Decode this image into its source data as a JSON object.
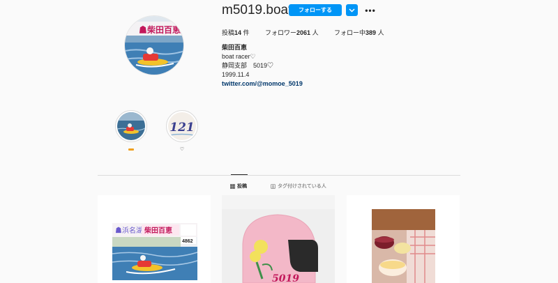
{
  "profile": {
    "username": "m5019.boat",
    "follow_label": "フォローする",
    "name": "柴田百恵",
    "bio_lines": [
      "boat racer♡",
      "静岡支部　5019♡",
      "1999.11.4"
    ],
    "link": "twitter.com/@momoe_5019"
  },
  "stats": {
    "posts_label": "投稿",
    "posts_count": "14",
    "posts_unit": "件",
    "followers_label": "フォロワー",
    "followers_count": "2061",
    "followers_unit": "人",
    "following_label": "フォロー中",
    "following_count": "389",
    "following_unit": "人"
  },
  "highlights": [
    {
      "label": ""
    },
    {
      "label": "♡",
      "image_text": "121"
    }
  ],
  "tabs": [
    {
      "label": "投稿"
    },
    {
      "label": "タグ付けされている人"
    }
  ],
  "posts": [
    {
      "banner_text": "柴田百恵",
      "number": "4862"
    },
    {
      "helmet_text": "5019"
    },
    {}
  ],
  "colors": {
    "accent": "#0095f6",
    "link": "#00376b"
  }
}
